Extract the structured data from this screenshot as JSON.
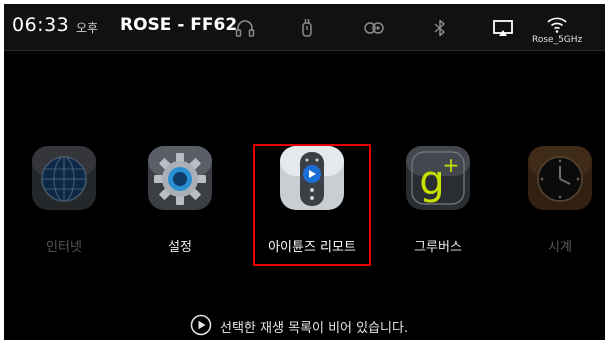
{
  "statusbar": {
    "time": "06:33",
    "ampm": "오후",
    "device_name": "ROSE - FF62",
    "icons": [
      "headphones-icon",
      "usb-icon",
      "record-icon",
      "bluetooth-icon",
      "airplay-icon",
      "wifi-icon"
    ],
    "wifi_label": "Rose_5GHz"
  },
  "apps": [
    {
      "label": "인터넷",
      "icon": "globe-icon"
    },
    {
      "label": "설정",
      "icon": "gear-icon"
    },
    {
      "label": "아이튠즈 리모트",
      "icon": "remote-icon"
    },
    {
      "label": "그루버스",
      "icon": "groovers-icon"
    },
    {
      "label": "시계",
      "icon": "clock-icon"
    }
  ],
  "playlist": {
    "message": "선택한 재생 목록이 비어 있습니다.",
    "icon": "play-circle-icon"
  },
  "colors": {
    "background": "#000000",
    "selection": "#e30000",
    "groovers_accent": "#c6e000",
    "remote_accent": "#1a6fd6"
  }
}
